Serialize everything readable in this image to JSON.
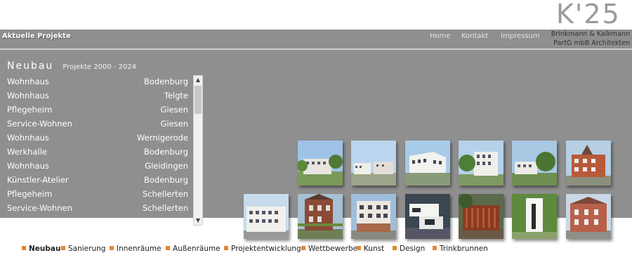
{
  "logo": {
    "text": "K'25"
  },
  "topbar": {
    "title": "Aktuelle Projekte",
    "nav": [
      "Home",
      "Kontakt",
      "Impressum"
    ],
    "firm_line1": "Brinkmann & Kalkmann",
    "firm_line2": "PartG mbB  Architekten"
  },
  "section": {
    "title": "Neubau",
    "subtitle": "Projekte 2000 - 2024"
  },
  "projects": [
    {
      "type": "Wohnhaus",
      "city": "Bodenburg"
    },
    {
      "type": "Wohnhaus",
      "city": "Telgte"
    },
    {
      "type": "Pflegeheim",
      "city": "Giesen"
    },
    {
      "type": "Service-Wohnen",
      "city": "Giesen"
    },
    {
      "type": "Wohnhaus",
      "city": "Wernigerode"
    },
    {
      "type": "Werkhalle",
      "city": "Bodenburg"
    },
    {
      "type": "Wohnhaus",
      "city": "Gleidingen"
    },
    {
      "type": "Künstler-Atelier",
      "city": "Bodenburg"
    },
    {
      "type": "Pflegeheim",
      "city": "Schellerten"
    },
    {
      "type": "Service-Wohnen",
      "city": "Schellerten"
    }
  ],
  "categories": [
    {
      "label": "Neubau",
      "active": true
    },
    {
      "label": "Sanierung",
      "active": false
    },
    {
      "label": "Innenräume",
      "active": false
    },
    {
      "label": "Außenräume",
      "active": false
    },
    {
      "label": "Projektentwicklung",
      "active": false
    },
    {
      "label": "Wettbewerbe",
      "active": false
    },
    {
      "label": "Kunst",
      "active": false
    },
    {
      "label": "Design",
      "active": false
    },
    {
      "label": "Trinkbrunnen",
      "active": false
    }
  ],
  "colors": {
    "bar_grey": "#8f8f8f",
    "accent_orange": "#e08a2a"
  },
  "scrollbar": {
    "up_icon": "scroll-up-arrow-icon",
    "down_icon": "scroll-down-arrow-icon"
  }
}
